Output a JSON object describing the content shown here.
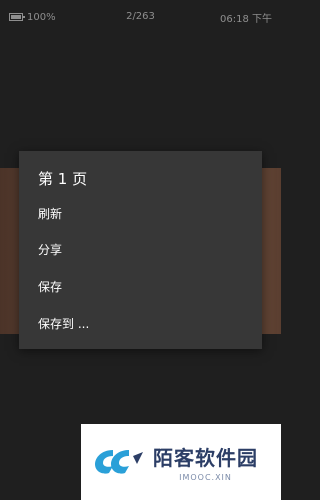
{
  "status_bar": {
    "battery": "100%",
    "page_counter": "2/263",
    "time": "06:18 下午"
  },
  "menu": {
    "title": "第 1 页",
    "items": [
      {
        "label": "刷新"
      },
      {
        "label": "分享"
      },
      {
        "label": "保存"
      },
      {
        "label": "保存到 ..."
      }
    ]
  },
  "watermark": {
    "title": "陌客软件园",
    "subtitle": "IMOOC.XIN"
  }
}
